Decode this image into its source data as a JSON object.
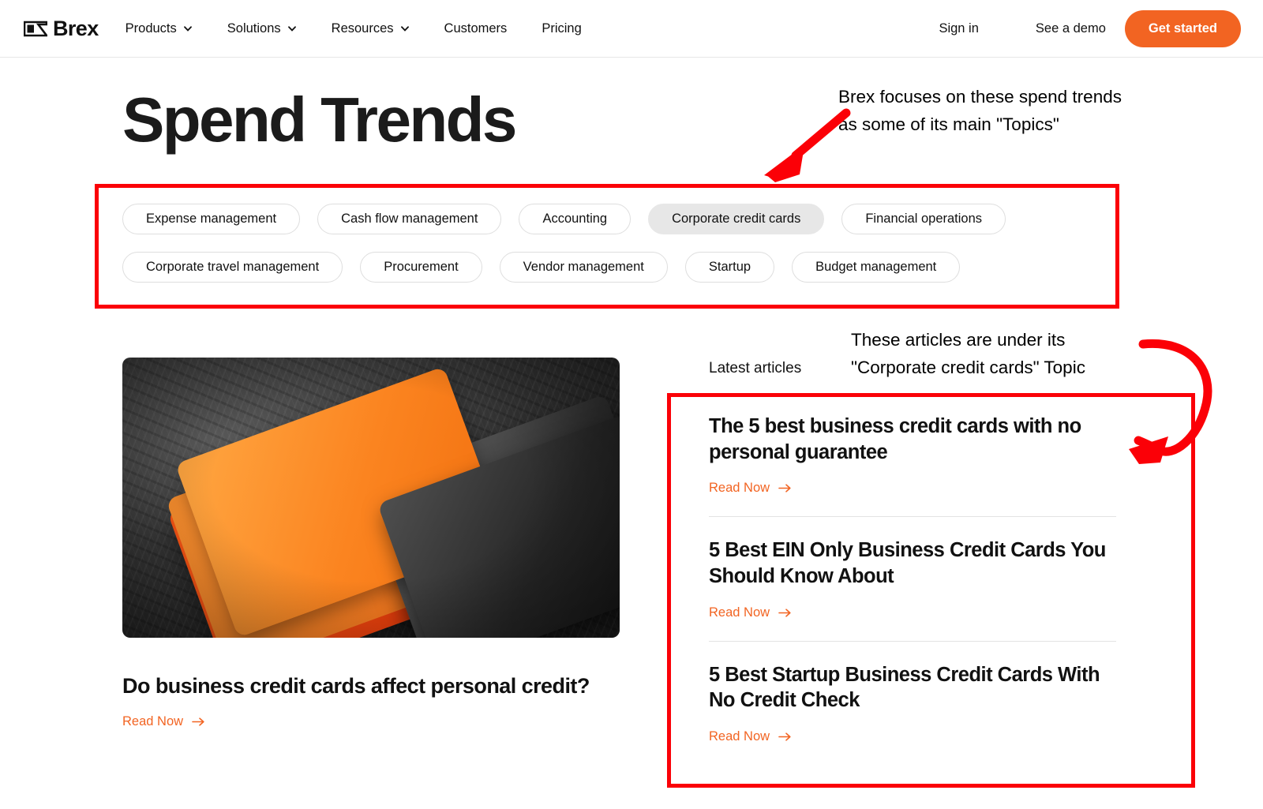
{
  "nav": {
    "logo_text": "Brex",
    "logo_icon": "brex-flag-logo-icon",
    "links": [
      {
        "label": "Products",
        "has_caret": true
      },
      {
        "label": "Solutions",
        "has_caret": true
      },
      {
        "label": "Resources",
        "has_caret": true
      },
      {
        "label": "Customers",
        "has_caret": false
      },
      {
        "label": "Pricing",
        "has_caret": false
      }
    ],
    "sign_in": "Sign in",
    "see_demo": "See a demo",
    "cta": "Get started"
  },
  "hero": {
    "title": "Spend Trends"
  },
  "topics": {
    "row1": [
      {
        "label": "Expense management",
        "active": false
      },
      {
        "label": "Cash flow management",
        "active": false
      },
      {
        "label": "Accounting",
        "active": false
      },
      {
        "label": "Corporate credit cards",
        "active": true
      },
      {
        "label": "Financial operations",
        "active": false
      }
    ],
    "row2": [
      {
        "label": "Corporate travel management",
        "active": false
      },
      {
        "label": "Procurement",
        "active": false
      },
      {
        "label": "Vendor management",
        "active": false
      },
      {
        "label": "Startup",
        "active": false
      },
      {
        "label": "Budget management",
        "active": false
      }
    ]
  },
  "featured": {
    "image_alt": "orange-and-black-credit-cards-on-slate",
    "title": "Do business credit cards affect personal credit?",
    "read_now": "Read Now"
  },
  "latest": {
    "label": "Latest articles",
    "articles": [
      {
        "title": "The 5 best business credit cards with no personal guarantee",
        "read_now": "Read Now"
      },
      {
        "title": "5 Best EIN Only Business Credit Cards You Should Know About",
        "read_now": "Read Now"
      },
      {
        "title": "5 Best Startup Business Credit Cards With No Credit Check",
        "read_now": "Read Now"
      }
    ]
  },
  "annotations": {
    "topics_note": "Brex focuses on these spend trends\nas some of its main \"Topics\"",
    "articles_note": "These articles are under its\n\"Corporate credit cards\" Topic",
    "highlight_color": "#fb0007"
  },
  "colors": {
    "brand_orange": "#f26422",
    "text": "#111111",
    "annotation_red": "#fb0007",
    "pill_active_bg": "#e7e7e7"
  }
}
